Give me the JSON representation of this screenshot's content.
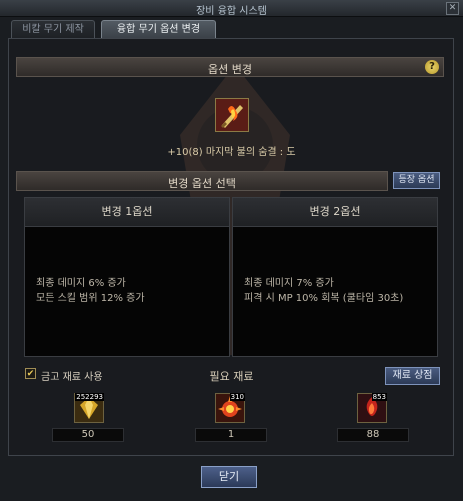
{
  "window": {
    "title": "장비 융합 시스템",
    "close_glyph": "✕"
  },
  "tabs": [
    {
      "label": "비칼 무기 제작",
      "active": false
    },
    {
      "label": "융합 무기 옵션 변경",
      "active": true
    }
  ],
  "option_change": {
    "header": "옵션 변경",
    "help_glyph": "?",
    "item_name": "+10(8) 마지막 불의 숨결 : 도",
    "item_icon": "flame-sword-icon"
  },
  "option_select": {
    "header": "변경 옵션 선택",
    "register_button": "등장 옵션",
    "options": [
      {
        "title": "변경 1옵션",
        "lines": [
          "최종 데미지 6% 증가",
          "모든 스킬 범위 12% 증가"
        ]
      },
      {
        "title": "변경 2옵션",
        "lines": [
          "최종 데미지 7% 증가",
          "피격 시 MP 10% 회복 (쿨타임 30초)"
        ]
      }
    ]
  },
  "materials": {
    "use_storage_checked": true,
    "check_glyph": "✔",
    "use_storage_label": "금고 재료 사용",
    "required_label": "필요 재료",
    "shop_button": "재료 상점",
    "items": [
      {
        "icon": "gold-crystal-icon",
        "owned": "252293",
        "required": "50",
        "color": "#c79a22"
      },
      {
        "icon": "fire-orb-icon",
        "owned": "310",
        "required": "1",
        "color": "#c4361b"
      },
      {
        "icon": "red-flame-gem-icon",
        "owned": "853",
        "required": "88",
        "color": "#b5261f"
      }
    ]
  },
  "footer": {
    "close_button": "닫기"
  },
  "colors": {
    "accent_blue": "#4a5c80",
    "gold_border": "#8b7a45",
    "panel_bg": "#191b1f"
  }
}
